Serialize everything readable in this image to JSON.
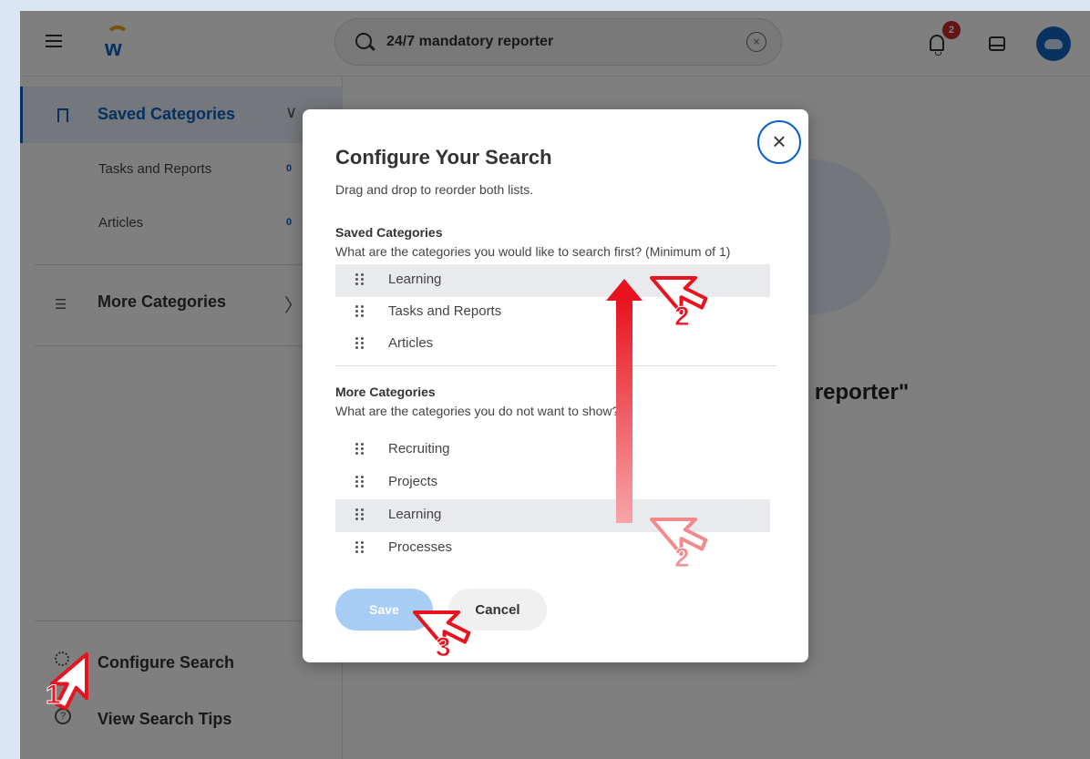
{
  "header": {
    "search_value": "24/7 mandatory reporter",
    "clear_label": "×",
    "notification_count": "2"
  },
  "sidebar": {
    "saved": {
      "label": "Saved Categories",
      "chevron": "∨"
    },
    "saved_items": [
      {
        "label": "Tasks and Reports",
        "count": "0"
      },
      {
        "label": "Articles",
        "count": "0"
      }
    ],
    "more": {
      "label": "More Categories",
      "chevron": "〉"
    },
    "configure": {
      "label": "Configure Search"
    },
    "tips": {
      "label": "View Search Tips"
    }
  },
  "main": {
    "no_results_text": "No results for \"24/7 mandatory reporter\""
  },
  "modal": {
    "close_label": "×",
    "title": "Configure Your Search",
    "subtitle": "Drag and drop to reorder both lists.",
    "saved_heading": "Saved Categories",
    "saved_question": "What are the categories you would like to search first? (Minimum of 1)",
    "saved_items": [
      "Learning",
      "Tasks and Reports",
      "Articles"
    ],
    "more_heading": "More Categories",
    "more_question": "What are the categories you do not want to show?",
    "more_items": [
      "Recruiting",
      "Projects",
      "Learning",
      "Processes"
    ],
    "save_label": "Save",
    "cancel_label": "Cancel"
  },
  "annotations": {
    "step1": "1",
    "step2": "2",
    "step3": "3",
    "colors": {
      "red": "#e8131f",
      "light_red": "#f28a8e"
    }
  }
}
